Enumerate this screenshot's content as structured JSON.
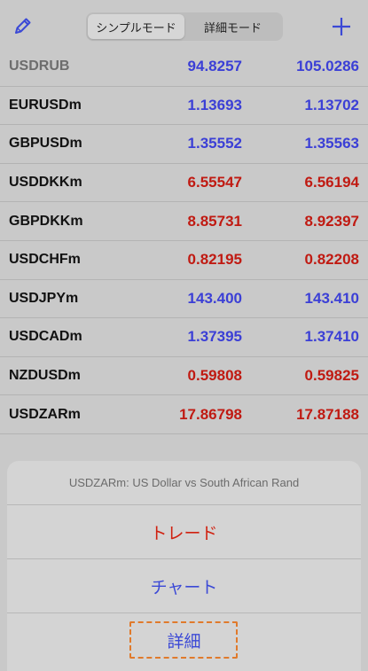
{
  "header": {
    "edit_icon": "pencil-icon",
    "segments": [
      "シンプルモード",
      "詳細モード"
    ],
    "active_segment": 0,
    "add_icon": "plus-icon",
    "accent_color": "#3b49d6"
  },
  "quotes": [
    {
      "symbol": "USDRUB",
      "bid": "94.8257",
      "ask": "105.0286",
      "dir": "up",
      "dim": true
    },
    {
      "symbol": "EURUSDm",
      "bid": "1.13693",
      "ask": "1.13702",
      "dir": "up",
      "dim": false
    },
    {
      "symbol": "GBPUSDm",
      "bid": "1.35552",
      "ask": "1.35563",
      "dir": "up",
      "dim": false
    },
    {
      "symbol": "USDDKKm",
      "bid": "6.55547",
      "ask": "6.56194",
      "dir": "down",
      "dim": false
    },
    {
      "symbol": "GBPDKKm",
      "bid": "8.85731",
      "ask": "8.92397",
      "dir": "down",
      "dim": false
    },
    {
      "symbol": "USDCHFm",
      "bid": "0.82195",
      "ask": "0.82208",
      "dir": "down",
      "dim": false
    },
    {
      "symbol": "USDJPYm",
      "bid": "143.400",
      "ask": "143.410",
      "dir": "up",
      "dim": false
    },
    {
      "symbol": "USDCADm",
      "bid": "1.37395",
      "ask": "1.37410",
      "dir": "up",
      "dim": false
    },
    {
      "symbol": "NZDUSDm",
      "bid": "0.59808",
      "ask": "0.59825",
      "dir": "down",
      "dim": false
    },
    {
      "symbol": "USDZARm",
      "bid": "17.86798",
      "ask": "17.87188",
      "dir": "down",
      "dim": false
    }
  ],
  "colors": {
    "up": "#3b3fd6",
    "down": "#c01a12",
    "highlight": "#e07a2c"
  },
  "action_sheet": {
    "title": "USDZARm: US Dollar vs South African Rand",
    "trade_label": "トレード",
    "chart_label": "チャート",
    "detail_label": "詳細"
  }
}
